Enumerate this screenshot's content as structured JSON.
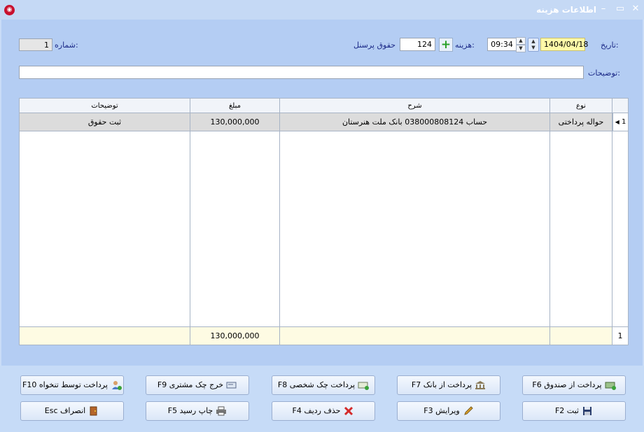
{
  "window": {
    "title": "اطلاعات هزینه"
  },
  "form": {
    "number_label": "شماره:",
    "number_value": "1",
    "date_label": "تاریخ:",
    "date_value": "1404/04/18",
    "time_value": "09:34",
    "expense_label": "هزینه:",
    "expense_code": "124",
    "expense_name": "حقوق پرسنل",
    "desc_label": "توضیحات:",
    "desc_value": ""
  },
  "grid": {
    "columns": [
      "نوع",
      "شرح",
      "مبلغ",
      "توضیحات"
    ],
    "rows": [
      {
        "index": "1",
        "type": "حواله پرداختی",
        "description": "حساب 038000808124 بانک ملت هنرستان",
        "amount": "130,000,000",
        "notes": "ثبت حقوق"
      }
    ],
    "footer": {
      "count": "1",
      "total": "130,000,000"
    }
  },
  "buttons": {
    "pay_cash": "پرداخت از صندوق F6",
    "pay_bank": "پرداخت از بانک F7",
    "pay_personal_check": "پرداخت چک شخصی F8",
    "customer_check": "خرج چک مشتری F9",
    "pay_salary": "پرداخت توسط تنخواه F10",
    "save": "ثبت F2",
    "edit": "ویرایش F3",
    "delete_row": "حذف ردیف F4",
    "print_receipt": "چاپ رسید F5",
    "cancel": "انصراف Esc"
  },
  "colors": {
    "accent": "#1c2a88",
    "date_highlight": "#fffaa8",
    "footer_bg": "#fefbe3"
  }
}
